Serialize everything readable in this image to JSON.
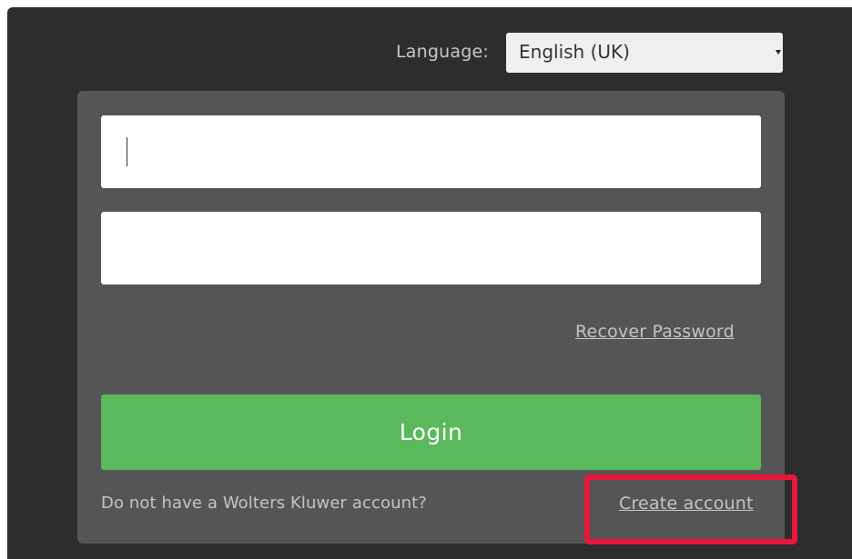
{
  "language": {
    "label": "Language:",
    "selected": "English (UK)"
  },
  "form": {
    "username_value": "",
    "password_value": "",
    "recover_label": "Recover Password",
    "login_label": "Login",
    "no_account_text": "Do not have a Wolters Kluwer account?",
    "create_account_label": "Create account"
  },
  "colors": {
    "outer_background": "#2d2d2d",
    "panel_background": "#555555",
    "login_button": "#5cb85c",
    "highlight": "#e8163a"
  }
}
